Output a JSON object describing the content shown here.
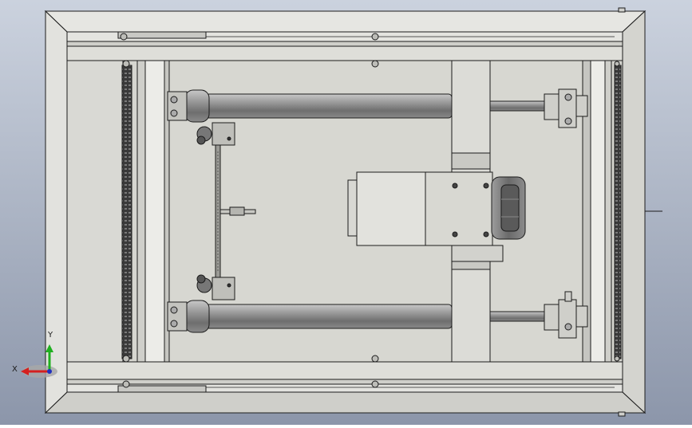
{
  "viewport": {
    "background_top": "#c9d0dc",
    "background_bottom": "#8e97ab",
    "model_fill": "#d8d8d2",
    "frame_fill": "#dededa",
    "edge_color": "#1c1c1c",
    "roller_color": "#8f8f8f"
  },
  "triad": {
    "x_label": "X",
    "y_label": "Y",
    "x_color": "#d42020",
    "y_color": "#20b020",
    "z_color": "#2030c0"
  }
}
